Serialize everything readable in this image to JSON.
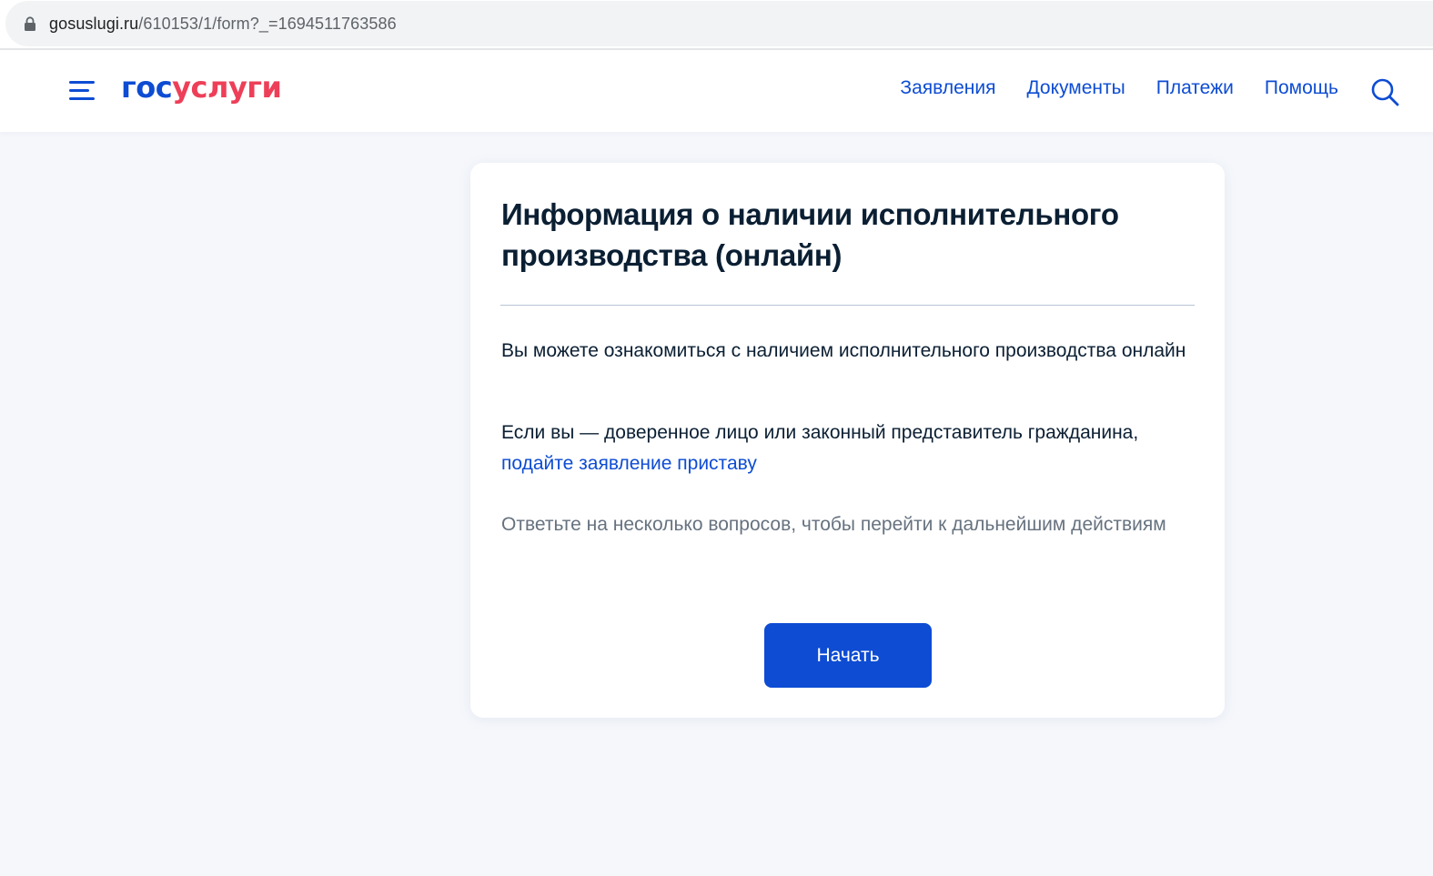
{
  "browser": {
    "url_domain": "gosuslugi.ru",
    "url_path": "/610153/1/form?_=1694511763586"
  },
  "header": {
    "logo_part1": "гос",
    "logo_part2": "услуги",
    "nav": [
      "Заявления",
      "Документы",
      "Платежи",
      "Помощь"
    ]
  },
  "card": {
    "title": "Информация о наличии исполнительного производства (онлайн)",
    "paragraph1": "Вы можете ознакомиться с наличием исполнительного производства онлайн",
    "paragraph2_text": "Если вы — доверенное лицо или законный представитель гражданина, ",
    "paragraph2_link": "подайте заявление приставу",
    "paragraph3": "Ответьте на несколько вопросов, чтобы перейти к дальнейшим действиям",
    "start_button": "Начать"
  },
  "colors": {
    "brand_blue": "#0d4cd3",
    "brand_red": "#ee3f58",
    "page_bg": "#f5f7fb",
    "text_dark": "#0b1f33",
    "text_muted": "#66727f"
  },
  "icons": [
    "lock-icon",
    "menu-icon",
    "search-icon"
  ]
}
